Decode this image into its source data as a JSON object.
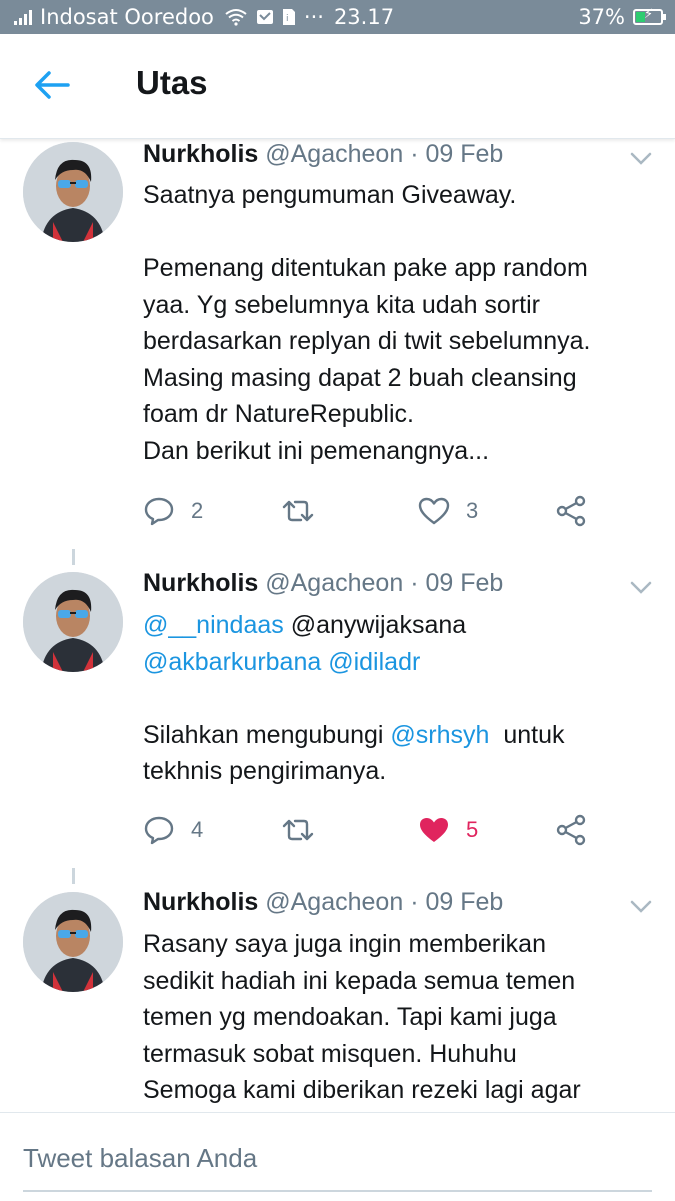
{
  "status_bar": {
    "carrier": "Indosat Ooredoo",
    "dots": "···",
    "time": "23.17",
    "battery": "37%",
    "battery_level": 0.37
  },
  "header": {
    "title": "Utas"
  },
  "tweets": [
    {
      "name": "Nurkholis",
      "handle": "@Agacheon",
      "sep": "·",
      "date": "09 Feb",
      "lines": [
        "Saatnya pengumuman Giveaway.",
        "",
        "Pemenang ditentukan pake app random",
        "yaa. Yg sebelumnya kita udah sortir",
        "berdasarkan replyan di twit sebelumnya.",
        "Masing masing dapat 2 buah cleansing",
        "foam dr NatureRepublic.",
        "Dan berikut ini pemenangnya..."
      ],
      "reply_count": "2",
      "like_count": "3"
    },
    {
      "name": "Nurkholis",
      "handle": "@Agacheon",
      "sep": "·",
      "date": "09 Feb",
      "mention1": "@__nindaas",
      "plain1": " @anywijaksana",
      "mention2": "@akbarkurbana",
      "mention3": "@idiladr",
      "line4_pre": "Silahkan mengubungi ",
      "mention4": "@srhsyh",
      "line4_post": "  untuk",
      "line5": "tekhnis pengirimanya.",
      "reply_count": "4",
      "like_count": "5"
    },
    {
      "name": "Nurkholis",
      "handle": "@Agacheon",
      "sep": "·",
      "date": "09 Feb",
      "lines": [
        "Rasany saya juga ingin memberikan",
        "sedikit hadiah ini kepada semua temen",
        "temen yg mendoakan. Tapi kami juga",
        "termasuk sobat misquen. Huhuhu",
        "Semoga kami diberikan rezeki lagi agar"
      ]
    }
  ],
  "reply_bar": {
    "placeholder": "Tweet balasan Anda"
  },
  "colors": {
    "accent": "#1da1f2",
    "mention": "#1b95e0",
    "like": "#e0245e",
    "muted": "#657786"
  }
}
